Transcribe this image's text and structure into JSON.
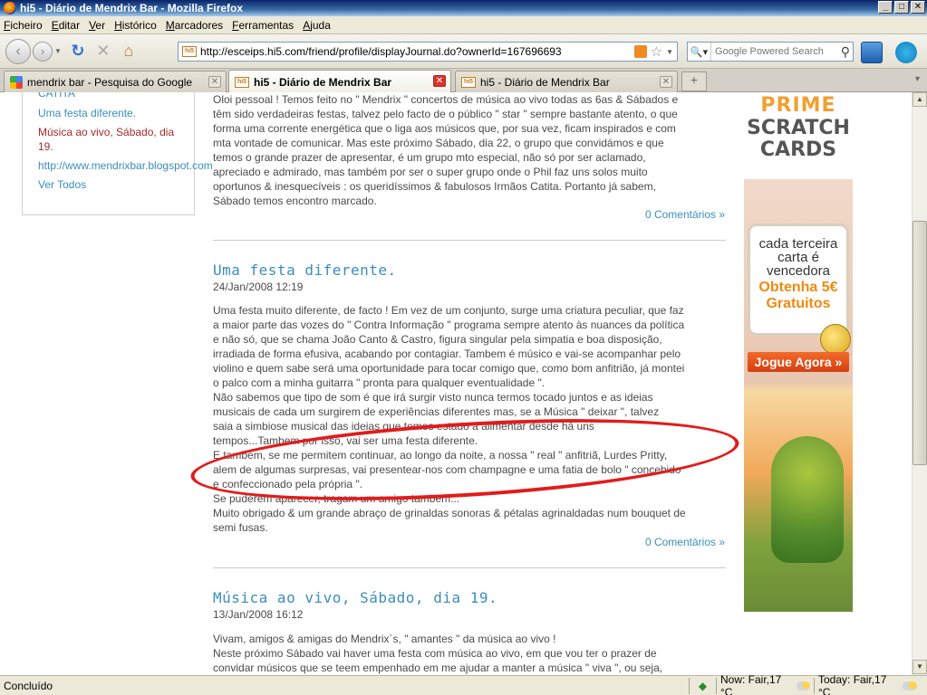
{
  "window": {
    "title": "hi5 - Diário de Mendrix Bar - Mozilla Firefox",
    "min": "_",
    "max": "□",
    "close": "✕"
  },
  "menu": [
    "Ficheiro",
    "Editar",
    "Ver",
    "Histórico",
    "Marcadores",
    "Ferramentas",
    "Ajuda"
  ],
  "nav": {
    "back": "‹",
    "forward": "›",
    "reload": "↻",
    "stop": "✕",
    "home": "⌂",
    "url": "http://esceips.hi5.com/friend/profile/displayJournal.do?ownerId=167696693",
    "favicon_text": "hi5",
    "search_placeholder": "Google Powered Search"
  },
  "tabs": [
    {
      "label": "mendrix bar - Pesquisa do Google",
      "favicon": "google-icon"
    },
    {
      "label": "hi5 - Diário de Mendrix Bar",
      "favicon": "hi5-icon",
      "active": true
    },
    {
      "label": "hi5 - Diário de Mendrix Bar",
      "favicon": "hi5-icon"
    }
  ],
  "sidebar": {
    "items": [
      {
        "label": "CATITA",
        "current": false
      },
      {
        "label": "Uma festa diferente.",
        "current": false
      },
      {
        "label": "Música ao vivo, Sábado, dia",
        "current": true
      },
      {
        "label": "19.",
        "current": true
      },
      {
        "label": "http://www.mendrixbar.blogspot.com",
        "current": false
      },
      {
        "label": "Ver Todos",
        "current": false
      }
    ]
  },
  "posts": [
    {
      "body": [
        "Oloi pessoal ! Temos feito no \" Mendrix \" concertos de música ao vivo todas as 6as & Sábados e",
        "têm sido verdadeiras festas, talvez pelo facto de o público \" star \" sempre bastante atento, o que",
        "forma uma corrente energética que o liga aos músicos que, por sua vez, ficam inspirados e com",
        "mta vontade de comunicar. Mas este próximo Sábado, dia 22, o grupo que convidámos e que",
        "temos o grande prazer de apresentar, é um grupo mto especial, não só por ser aclamado,",
        "apreciado e admirado, mas também por ser o super grupo onde o Phil faz uns solos muito",
        "oportunos & inesquecíveis : os queridíssimos & fabulosos Irmãos Catita. Portanto já sabem,",
        "Sábado temos encontro marcado."
      ],
      "comments": "0 Comentários »"
    },
    {
      "title": "Uma festa diferente.",
      "date": "24/Jan/2008 12:19",
      "body": [
        "Uma festa muito diferente, de facto ! Em vez de um conjunto, surge uma criatura peculiar, que faz",
        "a maior parte das vozes do \" Contra Informação \" programa sempre atento às nuances da política",
        "e não só, que se chama João Canto & Castro, figura singular pela simpatia e boa disposição,",
        "irradiada de forma efusiva, acabando por contagiar. Tambem é músico e vai-se acompanhar pelo",
        "violino e quem sabe será uma oportunidade para tocar comigo que, como bom anfitrião, já montei",
        "o palco com a minha guitarra \" pronta para qualquer eventualidade \".",
        "Não sabemos que tipo de som é que irá surgir visto nunca termos tocado juntos e as ideias",
        "musicais de cada um surgirem de experiências diferentes mas, se a Música \" deixar \", talvez",
        "saia a simbiose musical das ideias que temos estado a alimentar desde há uns",
        "tempos...Tambem por isso, vai ser uma festa diferente.",
        "E tambem, se me permitem continuar, ao longo da noite, a nossa \" real \" anfitriã, Lurdes Pritty,",
        "alem de algumas surpresas, vai presentear-nos com champagne e uma fatia de bolo \" concebido",
        "e confeccionado pela própria \".",
        "Se puderem aparecer, tragam um amigo tambem...",
        "Muito obrigado & um grande abraço de grinaldas sonoras & pétalas agrinaldadas num bouquet de",
        "semi fusas."
      ],
      "comments": "0 Comentários »"
    },
    {
      "title": "Música ao vivo, Sábado, dia 19.",
      "date": "13/Jan/2008 16:12",
      "body": [
        "Vivam, amigos & amigas do Mendrix´s, \" amantes \" da música ao vivo !",
        "Neste próximo Sábado vai haver uma festa com música ao vivo, em que vou ter o prazer de",
        "convidar músicos que se teem empenhado em me ajudar a manter a música \" viva \", ou seja,"
      ]
    }
  ],
  "ad": {
    "brand_top": "PRIME",
    "brand_bottom": "SCRATCH\nCARDS",
    "tagline": "cada terceira carta é vencedora",
    "offer": "Obtenha 5€ Gratuitos",
    "cta": "Jogue Agora »",
    "accent": "#f08a10"
  },
  "status": {
    "text": "Concluído",
    "weather_now": "Now: Fair,17 °C",
    "weather_today": "Today: Fair,17 °C"
  },
  "colors": {
    "link": "#3a8dbd",
    "current_link": "#a52a2a",
    "annotation": "#e31b1b"
  }
}
